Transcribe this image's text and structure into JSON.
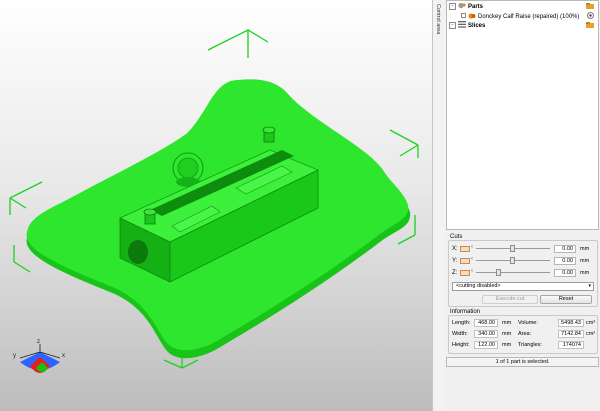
{
  "side_tab": {
    "label": "Control area"
  },
  "tree": {
    "parts_label": "Parts",
    "part_name": "Donckey Calf Raise (repaired) (100%)",
    "slices_label": "Slices"
  },
  "cuts": {
    "title": "Cuts",
    "rows": [
      {
        "axis": "X:",
        "value": "0.00",
        "unit": "mm",
        "position": 0.5
      },
      {
        "axis": "Y:",
        "value": "0.00",
        "unit": "mm",
        "position": 0.5
      },
      {
        "axis": "Z:",
        "value": "0.00",
        "unit": "mm",
        "position": 0.3
      }
    ],
    "mode_select": "<cutting disabled>",
    "execute_label": "Execute cut",
    "reset_label": "Reset"
  },
  "information": {
    "title": "Information",
    "length_label": "Length:",
    "length_value": "468.00",
    "length_unit": "mm",
    "width_label": "Width:",
    "width_value": "340.00",
    "width_unit": "mm",
    "height_label": "Height:",
    "height_value": "122.00",
    "height_unit": "mm",
    "volume_label": "Volume:",
    "volume_value": "5498.43",
    "volume_unit": "cm³",
    "area_label": "Area:",
    "area_value": "7142.84",
    "area_unit": "cm²",
    "triangles_label": "Triangles:",
    "triangles_value": "174074"
  },
  "status": {
    "text": "1 of 1 part is selected."
  },
  "axes": {
    "x": "x",
    "y": "y",
    "z": "z"
  },
  "colors": {
    "model": "#22e622",
    "bbox": "#00c800",
    "accent_orange": "#e88a1a"
  },
  "icons": [
    "folder-icon",
    "gear-icon",
    "eye-icon",
    "slices-icon",
    "checkbox-icon"
  ]
}
